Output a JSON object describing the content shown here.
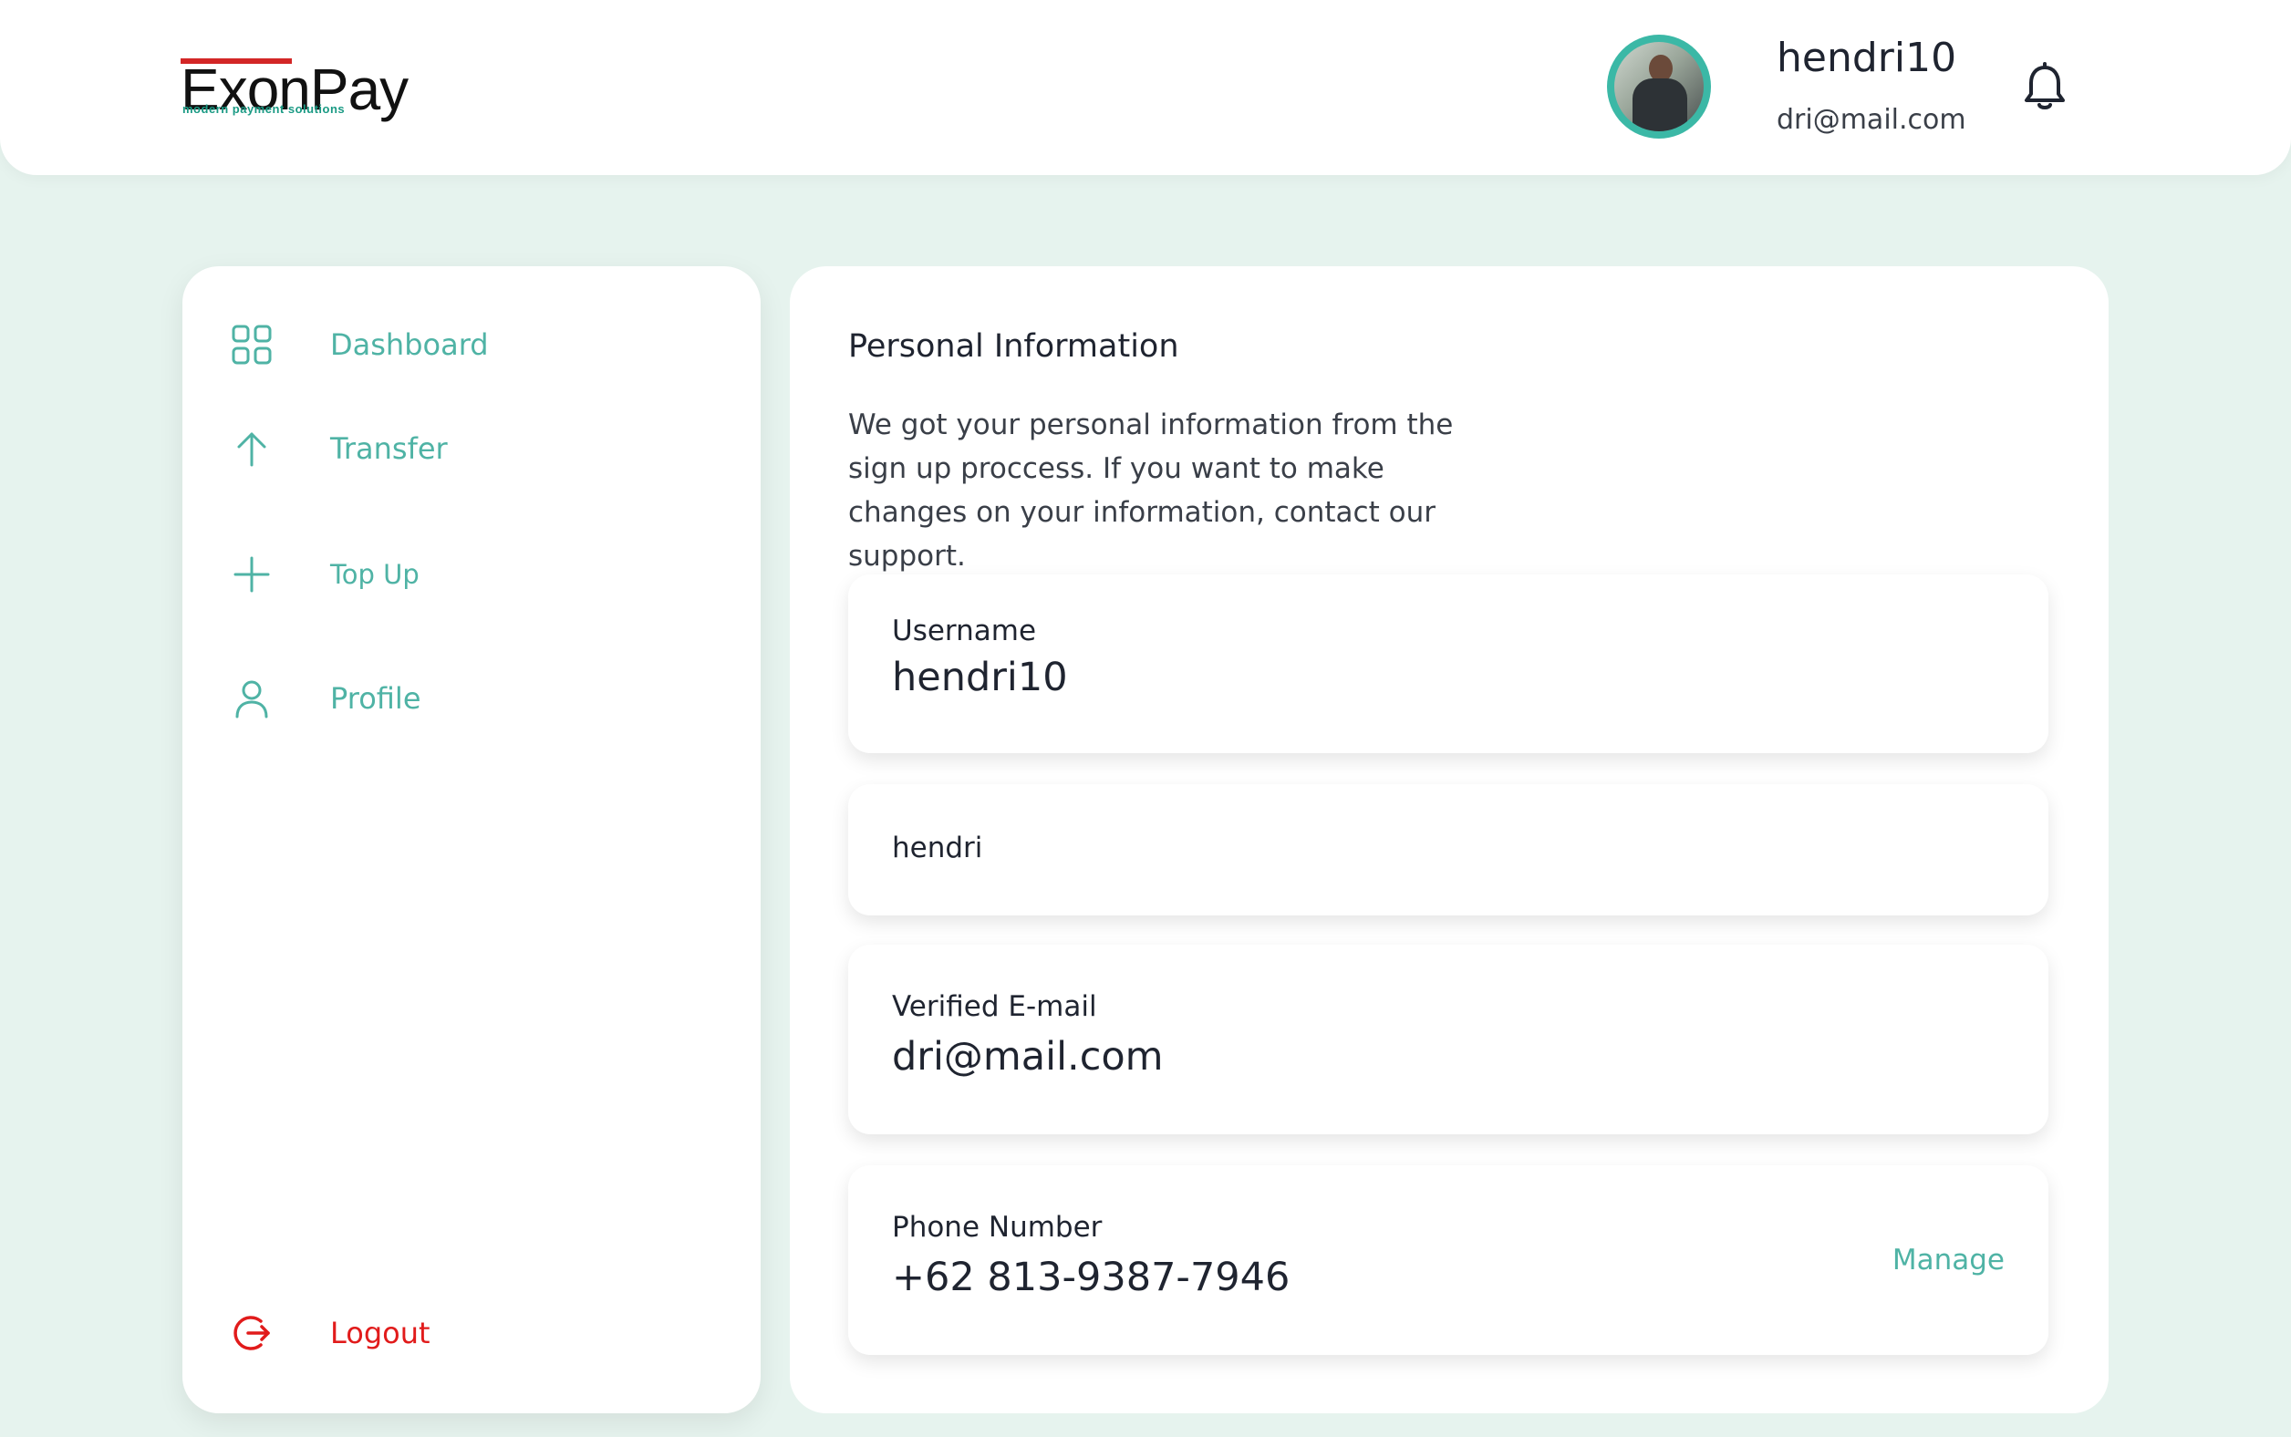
{
  "brand": {
    "name": "ExonPay",
    "tagline": "modern payment solutions"
  },
  "header": {
    "username": "hendri10",
    "email": "dri@mail.com",
    "avatar_icon": "user-avatar",
    "notification_icon": "bell-icon"
  },
  "sidebar": {
    "items": [
      {
        "label": "Dashboard",
        "icon": "grid-icon"
      },
      {
        "label": "Transfer",
        "icon": "arrow-up-icon"
      },
      {
        "label": "Top Up",
        "icon": "plus-icon"
      },
      {
        "label": "Profile",
        "icon": "user-icon"
      }
    ],
    "logout": {
      "label": "Logout",
      "icon": "logout-icon"
    }
  },
  "main": {
    "title": "Personal Information",
    "description": "We got your personal information from the sign up proccess. If you want to make changes on your information, contact our support.",
    "fields": [
      {
        "label": "Username",
        "value": "hendri10"
      },
      {
        "label": "",
        "value": "hendri"
      },
      {
        "label": "Verified E-mail",
        "value": "dri@mail.com"
      },
      {
        "label": "Phone Number",
        "value": "+62 813-9387-7946",
        "action": "Manage"
      }
    ]
  },
  "colors": {
    "accent": "#4fb3a5",
    "background": "#e6f3ee",
    "logout": "#e11b1b",
    "text": "#1f2430"
  }
}
